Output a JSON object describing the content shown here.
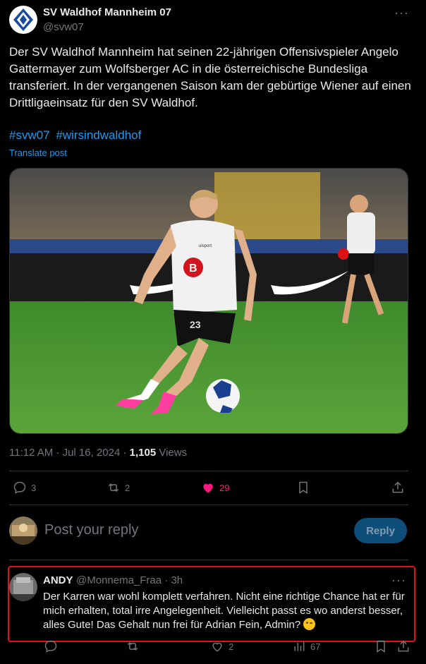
{
  "post": {
    "author_name": "SV Waldhof Mannheim 07",
    "author_handle": "@svw07",
    "more_label": "···",
    "text": "Der SV Waldhof Mannheim hat seinen 22-jährigen Offensivspieler Angelo Gattermayer zum Wolfsberger AC in die österreichische Bundesliga transferiert. In der vergangenen Saison kam der gebürtige Wiener auf einen Drittligaeinsatz für den SV Waldhof.",
    "hashtags": [
      "#svw07",
      "#wirsindwaldhof"
    ],
    "translate_label": "Translate post",
    "time": "11:12 AM · Jul 16, 2024 · ",
    "views_count": "1,105",
    "views_label": " Views",
    "player_number": "23",
    "sponsor_text": "ulsport"
  },
  "actions": {
    "replies": "3",
    "reposts": "2",
    "likes": "29"
  },
  "composer": {
    "placeholder": "Post your reply",
    "button_label": "Reply"
  },
  "comment": {
    "author_name": "ANDY",
    "author_handle": "@Monnema_Fraa · 3h",
    "more_label": "···",
    "text": "Der Karren war wohl komplett verfahren. Nicht eine richtige Chance hat er für mich erhalten, total irre Angelegenheit. Vielleicht passt es wo anderst besser, alles Gute! Das Gehalt nun frei für Adrian Fein, Admin? ",
    "replies": "",
    "reposts": "",
    "likes": "2",
    "views": "67"
  },
  "colors": {
    "accent": "#1d9bf0",
    "like": "#f91880",
    "muted": "#71767b",
    "reply_button_bg": "#0f4e78",
    "highlight": "#e0121b"
  },
  "icons": [
    "reply-icon",
    "repost-icon",
    "heart-icon",
    "bookmark-icon",
    "share-icon",
    "views-icon",
    "more-icon"
  ]
}
